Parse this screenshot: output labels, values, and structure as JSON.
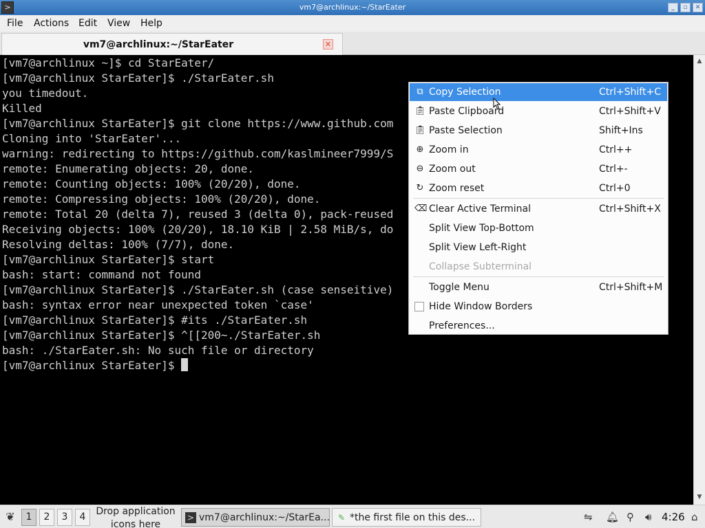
{
  "window": {
    "title": "vm7@archlinux:~/StarEater",
    "app_icon": "terminal-icon",
    "buttons": [
      "minimize",
      "maximize",
      "close"
    ]
  },
  "menubar": {
    "items": [
      "File",
      "Actions",
      "Edit",
      "View",
      "Help"
    ]
  },
  "tabs": [
    {
      "label": "vm7@archlinux:~/StarEater",
      "close_icon": "close-icon"
    }
  ],
  "terminal": {
    "lines": [
      "[vm7@archlinux ~]$ cd StarEater/",
      "[vm7@archlinux StarEater]$ ./StarEater.sh",
      "you timedout.",
      "Killed",
      "[vm7@archlinux StarEater]$ git clone https://www.github.com",
      "Cloning into 'StarEater'...",
      "warning: redirecting to https://github.com/kaslmineer7999/S",
      "remote: Enumerating objects: 20, done.",
      "remote: Counting objects: 100% (20/20), done.",
      "remote: Compressing objects: 100% (20/20), done.",
      "remote: Total 20 (delta 7), reused 3 (delta 0), pack-reused",
      "Receiving objects: 100% (20/20), 18.10 KiB | 2.58 MiB/s, do",
      "Resolving deltas: 100% (7/7), done.",
      "[vm7@archlinux StarEater]$ start",
      "bash: start: command not found",
      "[vm7@archlinux StarEater]$ ./StarEater.sh (case senseitive)",
      "bash: syntax error near unexpected token `case'",
      "[vm7@archlinux StarEater]$ #its ./StarEater.sh",
      "[vm7@archlinux StarEater]$ ^[[200~./StarEater.sh",
      "bash: ./StarEater.sh: No such file or directory"
    ],
    "prompt": "[vm7@archlinux StarEater]$ "
  },
  "context_menu": {
    "items": [
      {
        "label": "Copy Selection",
        "shortcut": "Ctrl+Shift+C",
        "icon": "copy-icon",
        "active": true
      },
      {
        "label": "Paste Clipboard",
        "shortcut": "Ctrl+Shift+V",
        "icon": "paste-icon"
      },
      {
        "label": "Paste Selection",
        "shortcut": "Shift+Ins",
        "icon": "paste-icon"
      },
      {
        "label": "Zoom in",
        "shortcut": "Ctrl++",
        "icon": "zoom-in-icon"
      },
      {
        "label": "Zoom out",
        "shortcut": "Ctrl+-",
        "icon": "zoom-out-icon"
      },
      {
        "label": "Zoom reset",
        "shortcut": "Ctrl+0",
        "icon": "zoom-reset-icon"
      },
      {
        "label": "Clear Active Terminal",
        "shortcut": "Ctrl+Shift+X",
        "icon": "clear-icon"
      },
      {
        "label": "Split View Top-Bottom",
        "shortcut": ""
      },
      {
        "label": "Split View Left-Right",
        "shortcut": ""
      },
      {
        "label": "Collapse Subterminal",
        "shortcut": "",
        "disabled": true
      },
      {
        "label": "Toggle Menu",
        "shortcut": "Ctrl+Shift+M"
      },
      {
        "label": "Hide Window Borders",
        "shortcut": "",
        "checkbox": true,
        "checked": false
      },
      {
        "label": "Preferences...",
        "shortcut": ""
      }
    ]
  },
  "taskbar": {
    "start_icon": "start-menu-icon",
    "workspaces": [
      "1",
      "2",
      "3",
      "4"
    ],
    "active_workspace": "1",
    "drop_text": "Drop application icons here",
    "tasks": [
      {
        "label": "vm7@archlinux:~/StarEa...",
        "icon": "terminal-icon",
        "active": true
      },
      {
        "label": "*the first file on this des...",
        "icon": "text-editor-icon",
        "active": false
      }
    ],
    "tray": [
      "network-icon",
      "notification-bell-icon",
      "usb-icon",
      "volume-icon"
    ],
    "clock": "4:26",
    "show_desktop_icon": "show-desktop-icon"
  },
  "colors": {
    "titlebar": "#3f7fc4",
    "menu_highlight": "#3d8ee6",
    "terminal_bg": "#000000",
    "terminal_fg": "#cfcfcf",
    "tab_close": "#d84b3e"
  }
}
